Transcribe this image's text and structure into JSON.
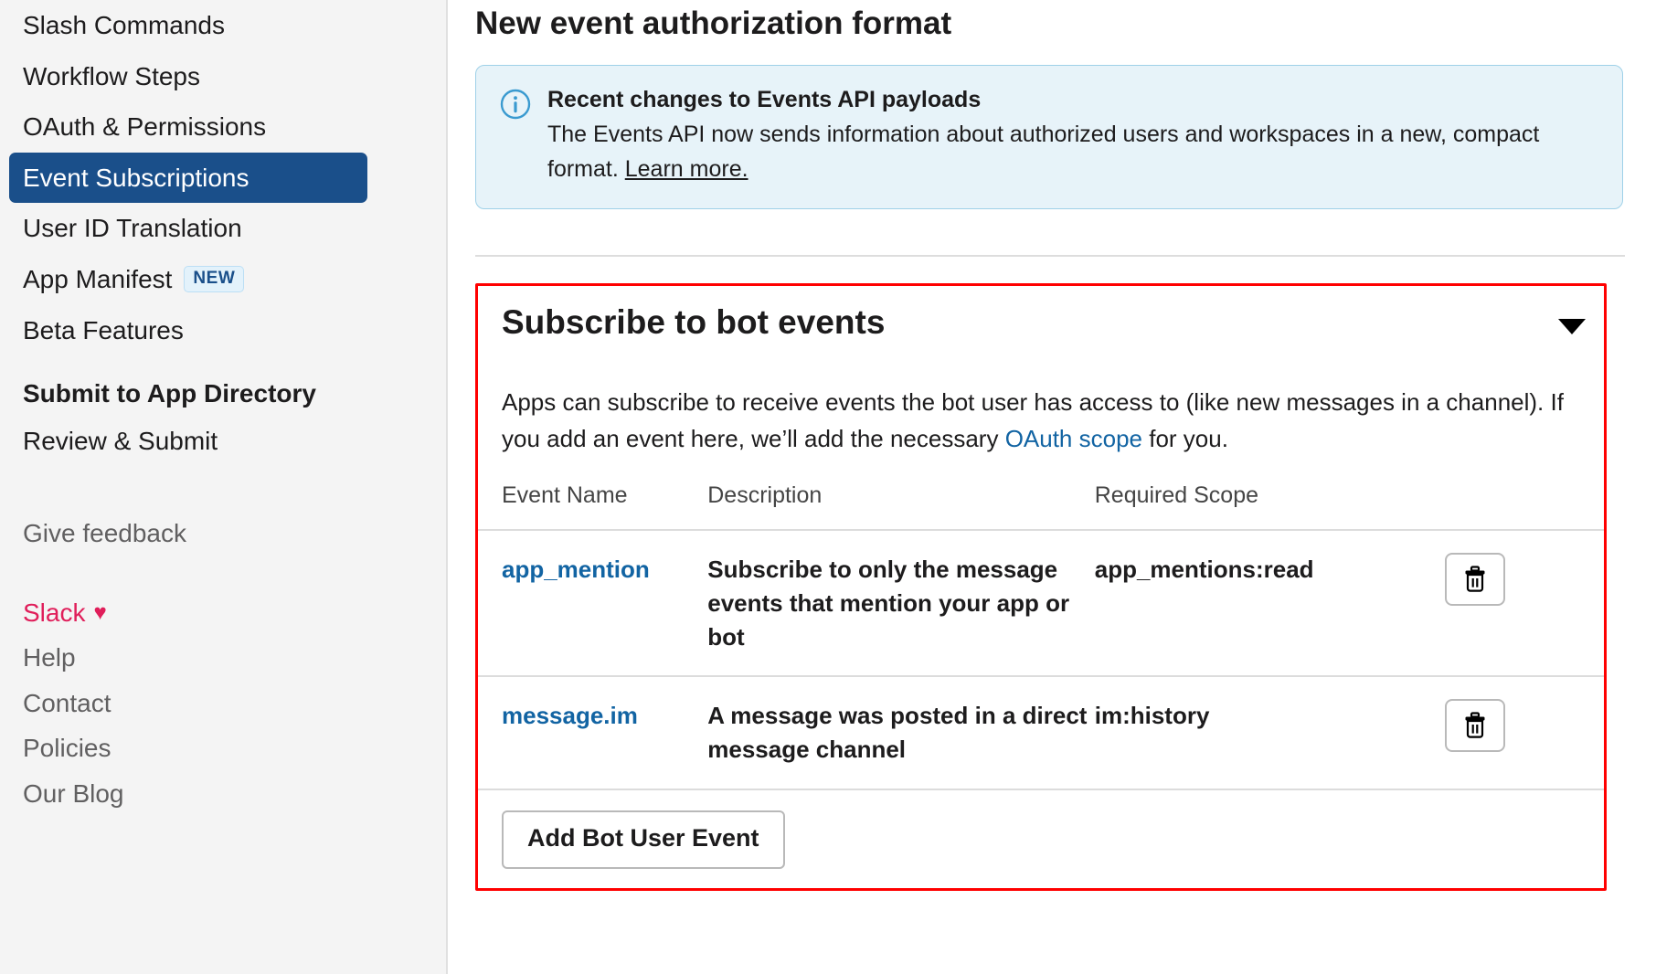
{
  "sidebar": {
    "nav_items": [
      {
        "label": "Slash Commands",
        "active": false
      },
      {
        "label": "Workflow Steps",
        "active": false
      },
      {
        "label": "OAuth & Permissions",
        "active": false
      },
      {
        "label": "Event Subscriptions",
        "active": true
      },
      {
        "label": "User ID Translation",
        "active": false
      }
    ],
    "app_manifest": {
      "label": "App Manifest",
      "badge": "NEW"
    },
    "beta_features": "Beta Features",
    "submit_heading": "Submit to App Directory",
    "review_submit": "Review & Submit",
    "give_feedback": "Give feedback",
    "slack_brand": "Slack",
    "heart": "♥",
    "footer_links": [
      "Help",
      "Contact",
      "Policies",
      "Our Blog"
    ]
  },
  "main": {
    "page_title": "New event authorization format",
    "info_banner": {
      "icon": "info-icon",
      "title": "Recent changes to Events API payloads",
      "text_before_link": "The Events API now sends information about authorized users and workspaces in a new, compact format.",
      "link_label": "Learn more."
    },
    "subscribe_panel": {
      "title": "Subscribe to bot events",
      "collapse_icon": "chevron-down-icon",
      "description_part1": "Apps can subscribe to receive events the bot user has access to (like new messages in a channel). If you add an event here, we’ll add the necessary ",
      "description_link": "OAuth scope",
      "description_part2": " for you.",
      "table": {
        "headers": [
          "Event Name",
          "Description",
          "Required Scope",
          ""
        ],
        "rows": [
          {
            "event_name": "app_mention",
            "description": "Subscribe to only the message events that mention your app or bot",
            "required_scope": "app_mentions:read",
            "action_icon": "trash-icon"
          },
          {
            "event_name": "message.im",
            "description": "A message was posted in a direct message channel",
            "required_scope": "im:history",
            "action_icon": "trash-icon"
          }
        ]
      },
      "add_button": "Add Bot User Event"
    }
  },
  "colors": {
    "sidebar_bg": "#f4f4f4",
    "active_nav": "#1a4f8a",
    "link_blue": "#1264a3",
    "slack_pink": "#e01e5a",
    "banner_bg": "#e7f3f9",
    "banner_border": "#9fd1e8",
    "highlight_red": "#ff0000",
    "badge_bg": "#e3f2fb"
  }
}
